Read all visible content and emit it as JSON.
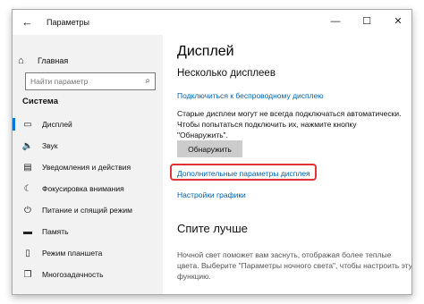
{
  "window": {
    "title": "Параметры"
  },
  "titlebar": {
    "back_icon": "back-arrow-icon",
    "minimize_glyph": "—",
    "maximize_glyph": "☐",
    "close_glyph": "✕"
  },
  "sidebar": {
    "home_label": "Главная",
    "home_icon": "home-icon",
    "search_placeholder": "Найти параметр",
    "section_title": "Система",
    "selected_index": 0,
    "items": [
      {
        "label": "Дисплей",
        "icon": "display-icon",
        "glyph": "▭"
      },
      {
        "label": "Звук",
        "icon": "speaker-icon",
        "glyph": "🔈"
      },
      {
        "label": "Уведомления и действия",
        "icon": "notifications-icon",
        "glyph": "▤"
      },
      {
        "label": "Фокусировка внимания",
        "icon": "focus-assist-icon",
        "glyph": "☾"
      },
      {
        "label": "Питание и спящий режим",
        "icon": "power-icon",
        "glyph": "⏻"
      },
      {
        "label": "Память",
        "icon": "storage-icon",
        "glyph": "▬"
      },
      {
        "label": "Режим планшета",
        "icon": "tablet-mode-icon",
        "glyph": "▯"
      },
      {
        "label": "Многозадачность",
        "icon": "multitasking-icon",
        "glyph": "❐"
      }
    ]
  },
  "main": {
    "title": "Дисплей",
    "multiple_displays_title": "Несколько дисплеев",
    "wireless_link": "Подключиться к беспроводному дисплею",
    "older_displays_line1": "Старые дисплеи могут не всегда подключаться автоматически.",
    "older_displays_line2": "Чтобы попытаться подключить их, нажмите кнопку",
    "older_displays_line3": "\"Обнаружить\".",
    "detect_button": "Обнаружить",
    "advanced_link": "Дополнительные параметры дисплея",
    "graphics_link": "Настройки графики",
    "sleep_title": "Спите лучше",
    "night_line1": "Ночной свет поможет вам заснуть, отображая более теплые",
    "night_line2": "цвета. Выберите \"Параметры ночного света\", чтобы настроить эту",
    "night_line3": "функцию."
  },
  "colors": {
    "accent": "#0078d7",
    "link": "#0063b1",
    "highlight": "#e2333a",
    "sidebar_bg": "#f2f2f2",
    "button_bg": "#cccccc"
  }
}
